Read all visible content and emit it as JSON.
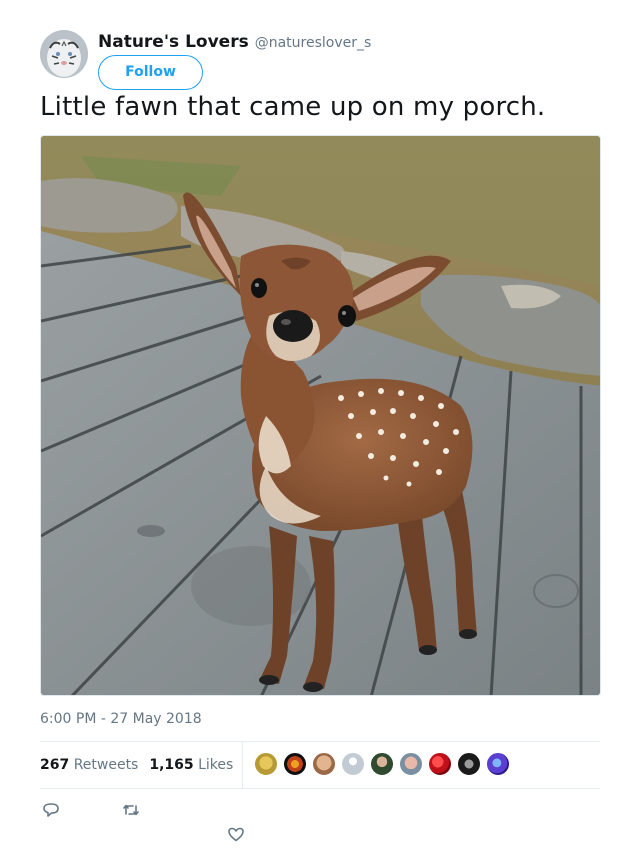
{
  "user": {
    "display_name": "Nature's Lovers",
    "handle": "@natureslover_s",
    "follow_label": "Follow"
  },
  "tweet": {
    "text": "Little fawn that came up on my porch.",
    "timestamp": "6:00 PM - 27 May 2018"
  },
  "stats": {
    "retweets_count": "267",
    "retweets_label": "Retweets",
    "likes_count": "1,165",
    "likes_label": "Likes"
  },
  "colors": {
    "accent": "#1da1f2",
    "secondary_text": "#657786",
    "divider": "#e6ecf0"
  },
  "icons": [
    "reply-icon",
    "retweet-icon",
    "like-icon"
  ]
}
